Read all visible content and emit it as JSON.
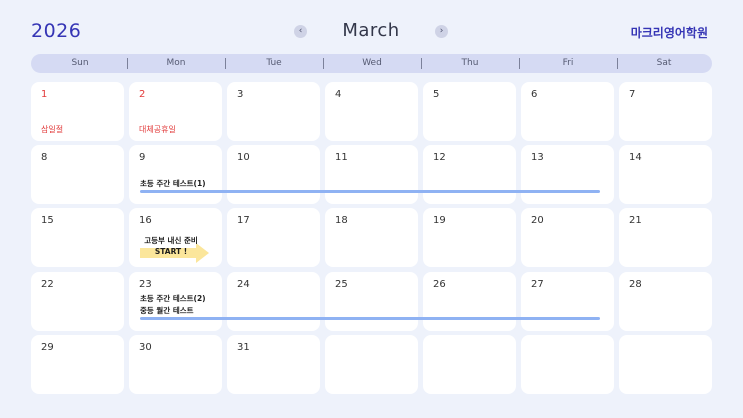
{
  "header": {
    "year": "2026",
    "month": "March",
    "prev_icon": "‹",
    "next_icon": "›",
    "academy_name": "마크리영어학원"
  },
  "weekdays": [
    "Sun",
    "Mon",
    "Tue",
    "Wed",
    "Thu",
    "Fri",
    "Sat"
  ],
  "days": [
    {
      "n": "1",
      "red": true,
      "holiday": "삼일절"
    },
    {
      "n": "2",
      "red": true,
      "holiday": "대체공휴일"
    },
    {
      "n": "3"
    },
    {
      "n": "4"
    },
    {
      "n": "5"
    },
    {
      "n": "6"
    },
    {
      "n": "7"
    },
    {
      "n": "8"
    },
    {
      "n": "9"
    },
    {
      "n": "10"
    },
    {
      "n": "11"
    },
    {
      "n": "12"
    },
    {
      "n": "13"
    },
    {
      "n": "14"
    },
    {
      "n": "15"
    },
    {
      "n": "16"
    },
    {
      "n": "17"
    },
    {
      "n": "18"
    },
    {
      "n": "19"
    },
    {
      "n": "20"
    },
    {
      "n": "21"
    },
    {
      "n": "22"
    },
    {
      "n": "23"
    },
    {
      "n": "24"
    },
    {
      "n": "25"
    },
    {
      "n": "26"
    },
    {
      "n": "27"
    },
    {
      "n": "28"
    },
    {
      "n": "29"
    },
    {
      "n": "30"
    },
    {
      "n": "31"
    },
    {
      "n": ""
    },
    {
      "n": ""
    },
    {
      "n": ""
    },
    {
      "n": ""
    }
  ],
  "events": {
    "week2_label": "초등 주간 테스트(1)",
    "week3_line1": "고등부 내신 준비",
    "week3_line2": "START !",
    "week4_label1": "초등 주간 테스트(2)",
    "week4_label2": "중등 월간 테스트"
  },
  "colors": {
    "accent": "#3535b5",
    "holiday": "#e23b3b",
    "event_bar": "#8fb2f3",
    "banner_arrow": "#fbe69b",
    "background": "#eef2fb",
    "weekday_bar": "#d5daf3"
  },
  "icons": {
    "prev": "chevron-left-icon",
    "next": "chevron-right-icon",
    "arrow": "arrow-right-icon"
  }
}
